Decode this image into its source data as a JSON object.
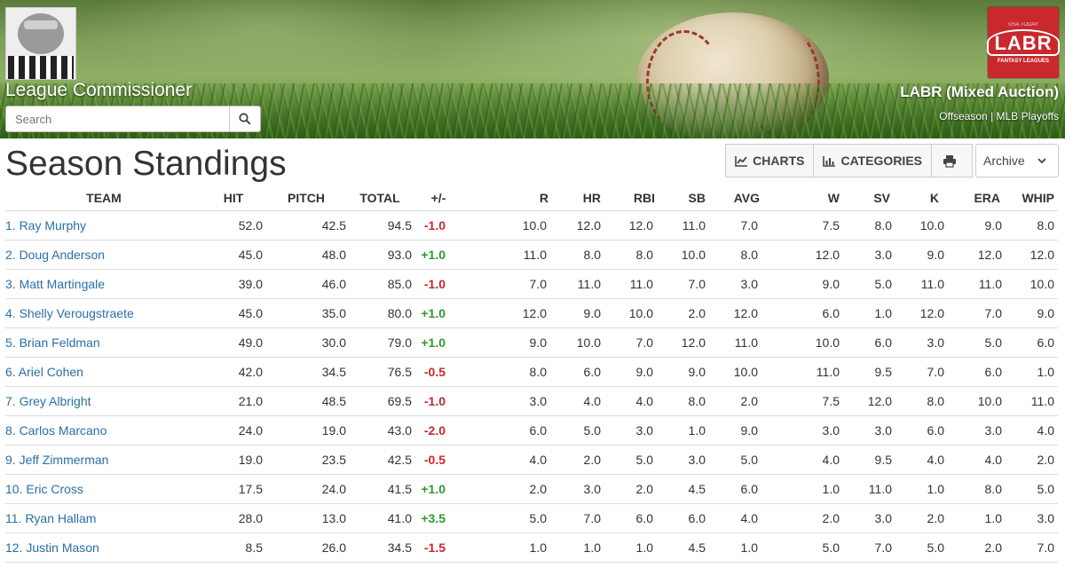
{
  "site": {
    "title": "League Commissioner",
    "search_placeholder": "Search"
  },
  "league": {
    "logo_text": "LABR",
    "logo_sub": "FANTASY LEAGUES",
    "logo_top": "USA TODAY",
    "name": "LABR (Mixed Auction)",
    "status": "Offseason | MLB Playoffs"
  },
  "page": {
    "title": "Season Standings",
    "toolbar": {
      "charts_label": "CHARTS",
      "categories_label": "CATEGORIES",
      "archive_label": "Archive"
    }
  },
  "standings": {
    "columns": [
      "TEAM",
      "HIT",
      "PITCH",
      "TOTAL",
      "+/-",
      "R",
      "HR",
      "RBI",
      "SB",
      "AVG",
      "W",
      "SV",
      "K",
      "ERA",
      "WHIP"
    ],
    "rows": [
      {
        "team": "1. Ray Murphy",
        "hit": "52.0",
        "pitch": "42.5",
        "total": "94.5",
        "delta": "-1.0",
        "r": "10.0",
        "hr": "12.0",
        "rbi": "12.0",
        "sb": "11.0",
        "avg": "7.0",
        "w": "7.5",
        "sv": "8.0",
        "k": "10.0",
        "era": "9.0",
        "whip": "8.0"
      },
      {
        "team": "2. Doug Anderson",
        "hit": "45.0",
        "pitch": "48.0",
        "total": "93.0",
        "delta": "+1.0",
        "r": "11.0",
        "hr": "8.0",
        "rbi": "8.0",
        "sb": "10.0",
        "avg": "8.0",
        "w": "12.0",
        "sv": "3.0",
        "k": "9.0",
        "era": "12.0",
        "whip": "12.0"
      },
      {
        "team": "3. Matt Martingale",
        "hit": "39.0",
        "pitch": "46.0",
        "total": "85.0",
        "delta": "-1.0",
        "r": "7.0",
        "hr": "11.0",
        "rbi": "11.0",
        "sb": "7.0",
        "avg": "3.0",
        "w": "9.0",
        "sv": "5.0",
        "k": "11.0",
        "era": "11.0",
        "whip": "10.0"
      },
      {
        "team": "4. Shelly Verougstraete",
        "hit": "45.0",
        "pitch": "35.0",
        "total": "80.0",
        "delta": "+1.0",
        "r": "12.0",
        "hr": "9.0",
        "rbi": "10.0",
        "sb": "2.0",
        "avg": "12.0",
        "w": "6.0",
        "sv": "1.0",
        "k": "12.0",
        "era": "7.0",
        "whip": "9.0"
      },
      {
        "team": "5. Brian Feldman",
        "hit": "49.0",
        "pitch": "30.0",
        "total": "79.0",
        "delta": "+1.0",
        "r": "9.0",
        "hr": "10.0",
        "rbi": "7.0",
        "sb": "12.0",
        "avg": "11.0",
        "w": "10.0",
        "sv": "6.0",
        "k": "3.0",
        "era": "5.0",
        "whip": "6.0"
      },
      {
        "team": "6. Ariel Cohen",
        "hit": "42.0",
        "pitch": "34.5",
        "total": "76.5",
        "delta": "-0.5",
        "r": "8.0",
        "hr": "6.0",
        "rbi": "9.0",
        "sb": "9.0",
        "avg": "10.0",
        "w": "11.0",
        "sv": "9.5",
        "k": "7.0",
        "era": "6.0",
        "whip": "1.0"
      },
      {
        "team": "7. Grey Albright",
        "hit": "21.0",
        "pitch": "48.5",
        "total": "69.5",
        "delta": "-1.0",
        "r": "3.0",
        "hr": "4.0",
        "rbi": "4.0",
        "sb": "8.0",
        "avg": "2.0",
        "w": "7.5",
        "sv": "12.0",
        "k": "8.0",
        "era": "10.0",
        "whip": "11.0"
      },
      {
        "team": "8. Carlos Marcano",
        "hit": "24.0",
        "pitch": "19.0",
        "total": "43.0",
        "delta": "-2.0",
        "r": "6.0",
        "hr": "5.0",
        "rbi": "3.0",
        "sb": "1.0",
        "avg": "9.0",
        "w": "3.0",
        "sv": "3.0",
        "k": "6.0",
        "era": "3.0",
        "whip": "4.0"
      },
      {
        "team": "9. Jeff Zimmerman",
        "hit": "19.0",
        "pitch": "23.5",
        "total": "42.5",
        "delta": "-0.5",
        "r": "4.0",
        "hr": "2.0",
        "rbi": "5.0",
        "sb": "3.0",
        "avg": "5.0",
        "w": "4.0",
        "sv": "9.5",
        "k": "4.0",
        "era": "4.0",
        "whip": "2.0"
      },
      {
        "team": "10. Eric Cross",
        "hit": "17.5",
        "pitch": "24.0",
        "total": "41.5",
        "delta": "+1.0",
        "r": "2.0",
        "hr": "3.0",
        "rbi": "2.0",
        "sb": "4.5",
        "avg": "6.0",
        "w": "1.0",
        "sv": "11.0",
        "k": "1.0",
        "era": "8.0",
        "whip": "5.0"
      },
      {
        "team": "11. Ryan Hallam",
        "hit": "28.0",
        "pitch": "13.0",
        "total": "41.0",
        "delta": "+3.5",
        "r": "5.0",
        "hr": "7.0",
        "rbi": "6.0",
        "sb": "6.0",
        "avg": "4.0",
        "w": "2.0",
        "sv": "3.0",
        "k": "2.0",
        "era": "1.0",
        "whip": "3.0"
      },
      {
        "team": "12. Justin Mason",
        "hit": "8.5",
        "pitch": "26.0",
        "total": "34.5",
        "delta": "-1.5",
        "r": "1.0",
        "hr": "1.0",
        "rbi": "1.0",
        "sb": "4.5",
        "avg": "1.0",
        "w": "5.0",
        "sv": "7.0",
        "k": "5.0",
        "era": "2.0",
        "whip": "7.0"
      }
    ]
  },
  "colors": {
    "link": "#2a6fa8",
    "positive": "#2e9b2e",
    "negative": "#c9282d",
    "labr_red": "#c9282d"
  }
}
